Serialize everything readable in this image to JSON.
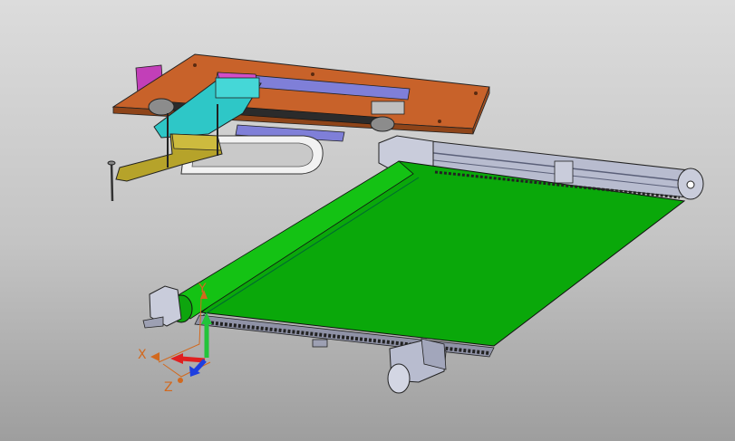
{
  "viewport": {
    "background_top": "#dcdcdc",
    "background_bottom": "#9e9e9e"
  },
  "triad": {
    "x_label": "X",
    "y_label": "Y",
    "z_label": "Z",
    "x_color": "#e02020",
    "y_color": "#22c43a",
    "z_color": "#1e3fe0",
    "label_color": "#d2691e"
  },
  "model": {
    "belt_color": "#0aa80a",
    "plate_color": "#c8622a",
    "frame_color": "#b8bccf",
    "carriage_color": "#2ec7c7",
    "bracket_color": "#b6a32a",
    "motor_color": "#c23fb8",
    "rail_color": "#7f7fd8"
  }
}
